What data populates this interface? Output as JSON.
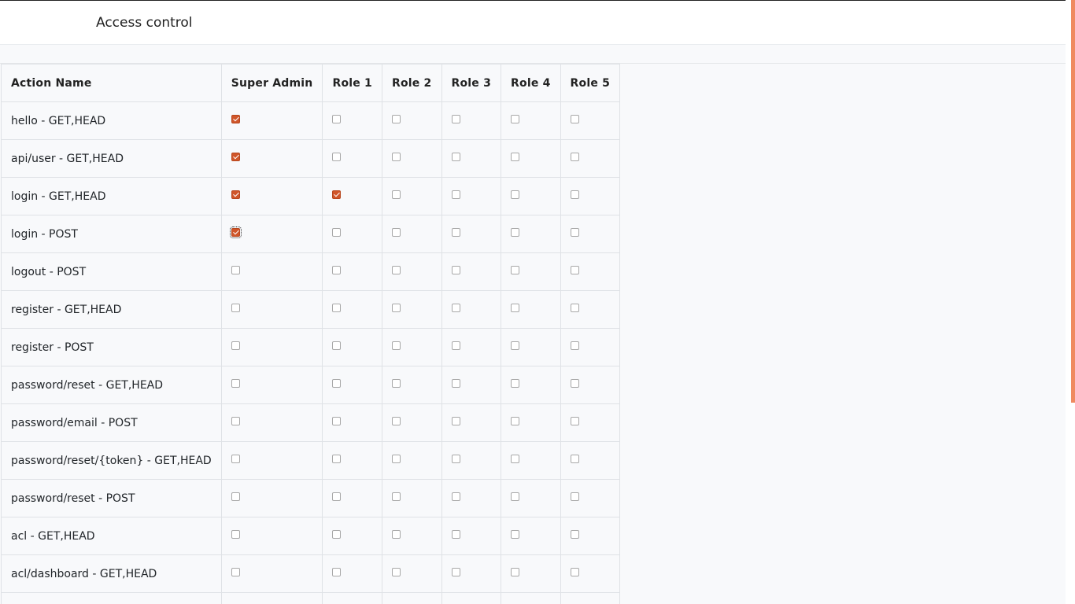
{
  "header": {
    "title": "Access control"
  },
  "table": {
    "columns": [
      "Action Name",
      "Super Admin",
      "Role 1",
      "Role 2",
      "Role 3",
      "Role 4",
      "Role 5"
    ],
    "rows": [
      {
        "action": "hello - GET,HEAD",
        "perms": [
          true,
          false,
          false,
          false,
          false,
          false
        ]
      },
      {
        "action": "api/user - GET,HEAD",
        "perms": [
          true,
          false,
          false,
          false,
          false,
          false
        ]
      },
      {
        "action": "login - GET,HEAD",
        "perms": [
          true,
          true,
          false,
          false,
          false,
          false
        ]
      },
      {
        "action": "login - POST",
        "perms": [
          true,
          false,
          false,
          false,
          false,
          false
        ],
        "focused_col": 0
      },
      {
        "action": "logout - POST",
        "perms": [
          false,
          false,
          false,
          false,
          false,
          false
        ]
      },
      {
        "action": "register - GET,HEAD",
        "perms": [
          false,
          false,
          false,
          false,
          false,
          false
        ]
      },
      {
        "action": "register - POST",
        "perms": [
          false,
          false,
          false,
          false,
          false,
          false
        ]
      },
      {
        "action": "password/reset - GET,HEAD",
        "perms": [
          false,
          false,
          false,
          false,
          false,
          false
        ]
      },
      {
        "action": "password/email - POST",
        "perms": [
          false,
          false,
          false,
          false,
          false,
          false
        ]
      },
      {
        "action": "password/reset/{token} - GET,HEAD",
        "perms": [
          false,
          false,
          false,
          false,
          false,
          false
        ]
      },
      {
        "action": "password/reset - POST",
        "perms": [
          false,
          false,
          false,
          false,
          false,
          false
        ]
      },
      {
        "action": "acl - GET,HEAD",
        "perms": [
          false,
          false,
          false,
          false,
          false,
          false
        ]
      },
      {
        "action": "acl/dashboard - GET,HEAD",
        "perms": [
          false,
          false,
          false,
          false,
          false,
          false
        ]
      },
      {
        "action": "",
        "perms": [
          false,
          false,
          false,
          false,
          false,
          false
        ],
        "partial": true
      }
    ]
  },
  "colors": {
    "checked": "#d0562a",
    "scroll_thumb": "#ef8a60"
  }
}
